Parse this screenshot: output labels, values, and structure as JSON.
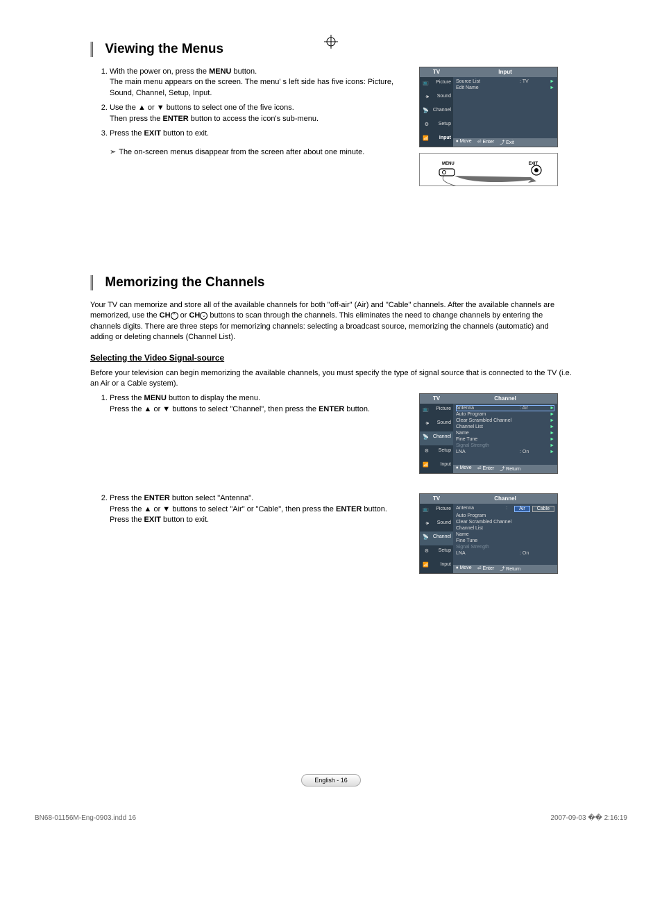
{
  "section1": {
    "title": "Viewing the Menus",
    "steps": [
      {
        "n": "1.",
        "html": "With the power on, press the <b>MENU</b> button.<br>The main menu appears on the screen. The menu' s left side has five icons: Picture, Sound, Channel, Setup, Input."
      },
      {
        "n": "2.",
        "html": "Use the ▲ or ▼ buttons to select one of the five icons.<br>Then press the <b>ENTER</b> button to access the icon's sub-menu."
      },
      {
        "n": "3.",
        "html": "Press the <b>EXIT</b> button to exit."
      }
    ],
    "note": "The on-screen menus disappear from the screen after about one minute.",
    "menu": {
      "tv_label": "TV",
      "title": "Input",
      "tabs": [
        "Picture",
        "Sound",
        "Channel",
        "Setup",
        "Input"
      ],
      "items": [
        {
          "label": "Source List",
          "value": ": TV",
          "arrow": "►"
        },
        {
          "label": "Edit Name",
          "value": "",
          "arrow": "►"
        }
      ],
      "footer": {
        "move": "Move",
        "enter": "Enter",
        "exit": "Exit"
      }
    },
    "remote": {
      "menu": "MENU",
      "exit": "EXIT"
    }
  },
  "section2": {
    "title": "Memorizing the Channels",
    "intro": "Your TV can memorize and store all of the available channels for both \"off-air\" (Air) and \"Cable\" channels. After the available channels are memorized, use the <b>CH</b><span class='ch-sym'>⌃</span> or <b>CH</b><span class='ch-sym'>⌄</span> buttons to scan through the channels. This eliminates the need to change channels by entering the channels digits. There are three steps for memorizing channels: selecting a broadcast source, memorizing the channels (automatic) and adding or deleting channels (Channel List).",
    "subheading": "Selecting the Video Signal-source",
    "pre": "Before your television can begin memorizing the available channels, you must specify the type of signal source that is connected to the TV (i.e. an Air or a Cable system).",
    "steps": [
      {
        "n": "1.",
        "html": "Press the <b>MENU</b> button to display the menu.<br>Press the ▲ or ▼ buttons to select \"Channel\", then press the <b>ENTER</b> button."
      },
      {
        "n": "2.",
        "html": "Press the <b>ENTER</b> button select \"Antenna\".<br>Press the ▲ or ▼ buttons to select \"Air\" or \"Cable\", then press the <b>ENTER</b> button.<br>Press the <b>EXIT</b> button to exit."
      }
    ],
    "menuA": {
      "tv_label": "TV",
      "title": "Channel",
      "tabs": [
        "Picture",
        "Sound",
        "Channel",
        "Setup",
        "Input"
      ],
      "active_tab": 2,
      "items": [
        {
          "label": "Antenna",
          "value": ": Air",
          "arrow": "►",
          "sel": true
        },
        {
          "label": "Auto Program",
          "arrow": "►"
        },
        {
          "label": "Clear Scrambled Channel",
          "arrow": "►"
        },
        {
          "label": "Channel List",
          "arrow": "►"
        },
        {
          "label": "Name",
          "arrow": "►"
        },
        {
          "label": "Fine Tune",
          "arrow": "►"
        },
        {
          "label": "Signal Strength",
          "arrow": "►",
          "dim": true
        },
        {
          "label": "LNA",
          "value": ": On",
          "arrow": "►"
        }
      ],
      "footer": {
        "move": "Move",
        "enter": "Enter",
        "ret": "Return"
      }
    },
    "menuB": {
      "tv_label": "TV",
      "title": "Channel",
      "tabs": [
        "Picture",
        "Sound",
        "Channel",
        "Setup",
        "Input"
      ],
      "active_tab": 2,
      "items": [
        {
          "label": "Antenna",
          "value": ":",
          "opts": [
            "Air",
            "Cable"
          ],
          "optsel": 0
        },
        {
          "label": "Auto Program"
        },
        {
          "label": "Clear Scrambled Channel"
        },
        {
          "label": "Channel List"
        },
        {
          "label": "Name"
        },
        {
          "label": "Fine Tune"
        },
        {
          "label": "Signal Strength",
          "dim": true
        },
        {
          "label": "LNA",
          "value": ": On"
        }
      ],
      "footer": {
        "move": "Move",
        "enter": "Enter",
        "ret": "Return"
      }
    }
  },
  "footer_page": "English - 16",
  "bottom_left": "BN68-01156M-Eng-0903.indd   16",
  "bottom_right": "2007-09-03   �� 2:16:19"
}
